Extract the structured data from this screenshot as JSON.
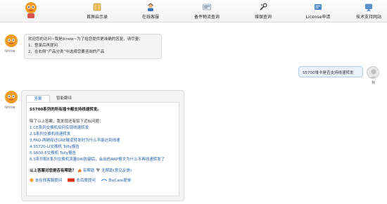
{
  "nav": {
    "items": [
      {
        "label": "首屏启示录",
        "icon": "book-icon"
      },
      {
        "label": "在线客服",
        "icon": "agent-icon"
      },
      {
        "label": "备件物流查询",
        "icon": "truck-icon"
      },
      {
        "label": "维保查询",
        "icon": "wrench-icon"
      },
      {
        "label": "License申请",
        "icon": "license-icon"
      },
      {
        "label": "技术支持网站",
        "icon": "globe-icon"
      }
    ]
  },
  "bot": {
    "name": "iknow"
  },
  "user": {
    "name": "我"
  },
  "welcome": {
    "line1": "欢迎您的访问~我是iknow~为了给您提供更准确的答复，请尽量：",
    "line2": "1、登录后再提问",
    "line3": "2、在右侧“产品分类”中选择您要咨询的产品"
  },
  "user_message": "S5700堆卡是否支持线速转发",
  "answer": {
    "tabs": [
      "答案",
      "智能翻译"
    ],
    "title": "S5700系列的所有插卡都支持线速转发。",
    "intro": "除了以上答案，我发现还有如下近似问题：",
    "related": [
      "1.CE系列交换机如何实现线速转发",
      "2.S系列交换机线速转发",
      "3.FAQ-两趟经过GRE隧道转发时为什么不能达到线速",
      "4.S5720-LI交换机 Tolly报告",
      "5.S600-E交换机 Tolly报告",
      "6.S系列和E系列交换机流量DAI防御后，会出的ARP报文为什么不再线速转发了"
    ],
    "feedback_question": "以上答案对您是否有帮助？",
    "feedback_yes": "有帮助",
    "feedback_no": "无帮助(意见反馈)",
    "actions": [
      "去在线客服提问",
      "去百度提问",
      "去eCare提单"
    ]
  },
  "colors": {
    "link": "#1f5fa8",
    "accent": "#e8731c",
    "user_bubble": "#eaf1fb"
  }
}
